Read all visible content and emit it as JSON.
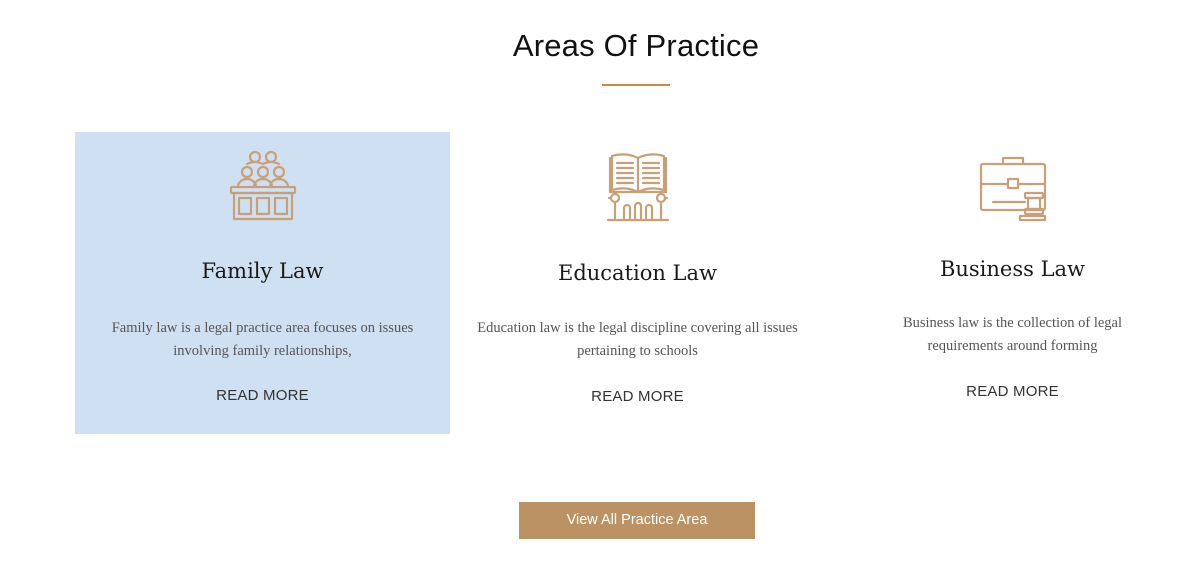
{
  "section": {
    "title": "Areas Of Practice",
    "accent_color": "#d08a3e",
    "icon_color": "#c8a078"
  },
  "cards": [
    {
      "title": "Family Law",
      "description": "Family law is a legal practice area focuses on issues involving family relationships,",
      "read_more": "READ MORE",
      "icon": "family-group-icon",
      "highlighted": true,
      "highlight_color": "#cfe0f2"
    },
    {
      "title": "Education Law",
      "description": "Education law is the legal discipline covering all issues pertaining to schools",
      "read_more": "READ MORE",
      "icon": "open-book-pillars-icon",
      "highlighted": false
    },
    {
      "title": "Business Law",
      "description": "Business law is the collection of legal requirements around forming",
      "read_more": "READ MORE",
      "icon": "briefcase-gavel-icon",
      "highlighted": false
    }
  ],
  "cta": {
    "label": "View All Practice Area",
    "color": "#bb9264"
  }
}
